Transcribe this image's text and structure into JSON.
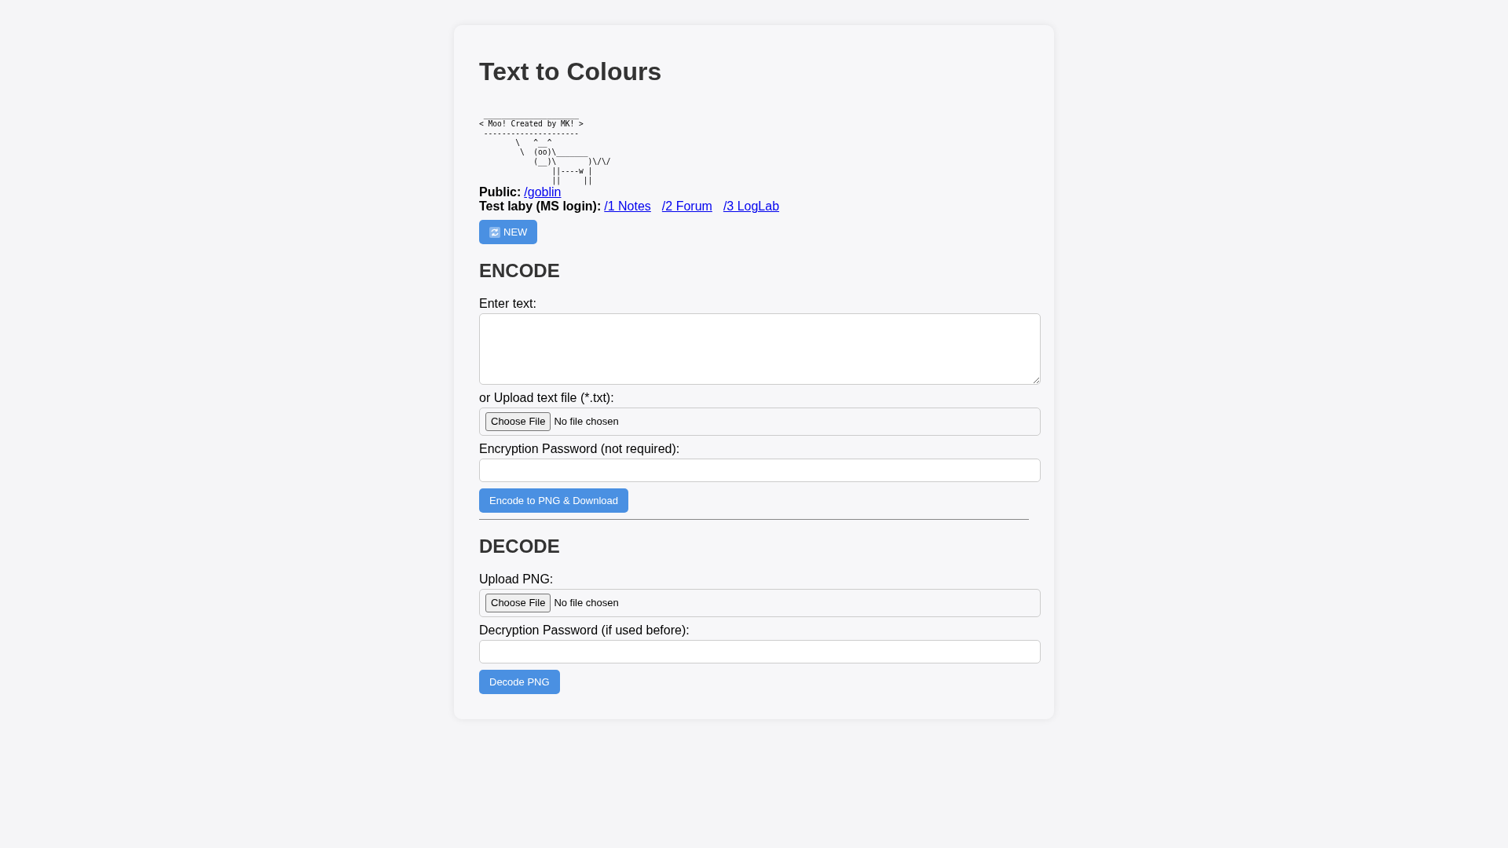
{
  "title": "Text to Colours",
  "ascii_art": [
    " _____________________",
    "< Moo! Created by MK! >",
    " ---------------------",
    "        \\   ^__^",
    "         \\  (oo)\\_______",
    "            (__)\\       )\\/\\/",
    "                ||----w |",
    "                ||     ||"
  ],
  "link_rows": [
    {
      "label": "Public:",
      "links": [
        "/goblin"
      ]
    },
    {
      "label": "Test laby (MS login):",
      "links": [
        "/1 Notes",
        "/2 Forum",
        "/3 LogLab"
      ]
    }
  ],
  "new_button": "NEW",
  "sections": [
    {
      "heading": "ENCODE",
      "fields": [
        {
          "kind": "textarea",
          "label": "Enter text:"
        },
        {
          "kind": "file",
          "label": "or Upload text file (*.txt):",
          "button": "Choose File",
          "status": "No file chosen"
        },
        {
          "kind": "password",
          "label": "Encryption Password (not required):"
        }
      ],
      "action": "Encode to PNG & Download"
    },
    {
      "heading": "DECODE",
      "fields": [
        {
          "kind": "file",
          "label": "Upload PNG:",
          "button": "Choose File",
          "status": "No file chosen"
        },
        {
          "kind": "password",
          "label": "Decryption Password (if used before):"
        }
      ],
      "action": "Decode PNG"
    }
  ]
}
